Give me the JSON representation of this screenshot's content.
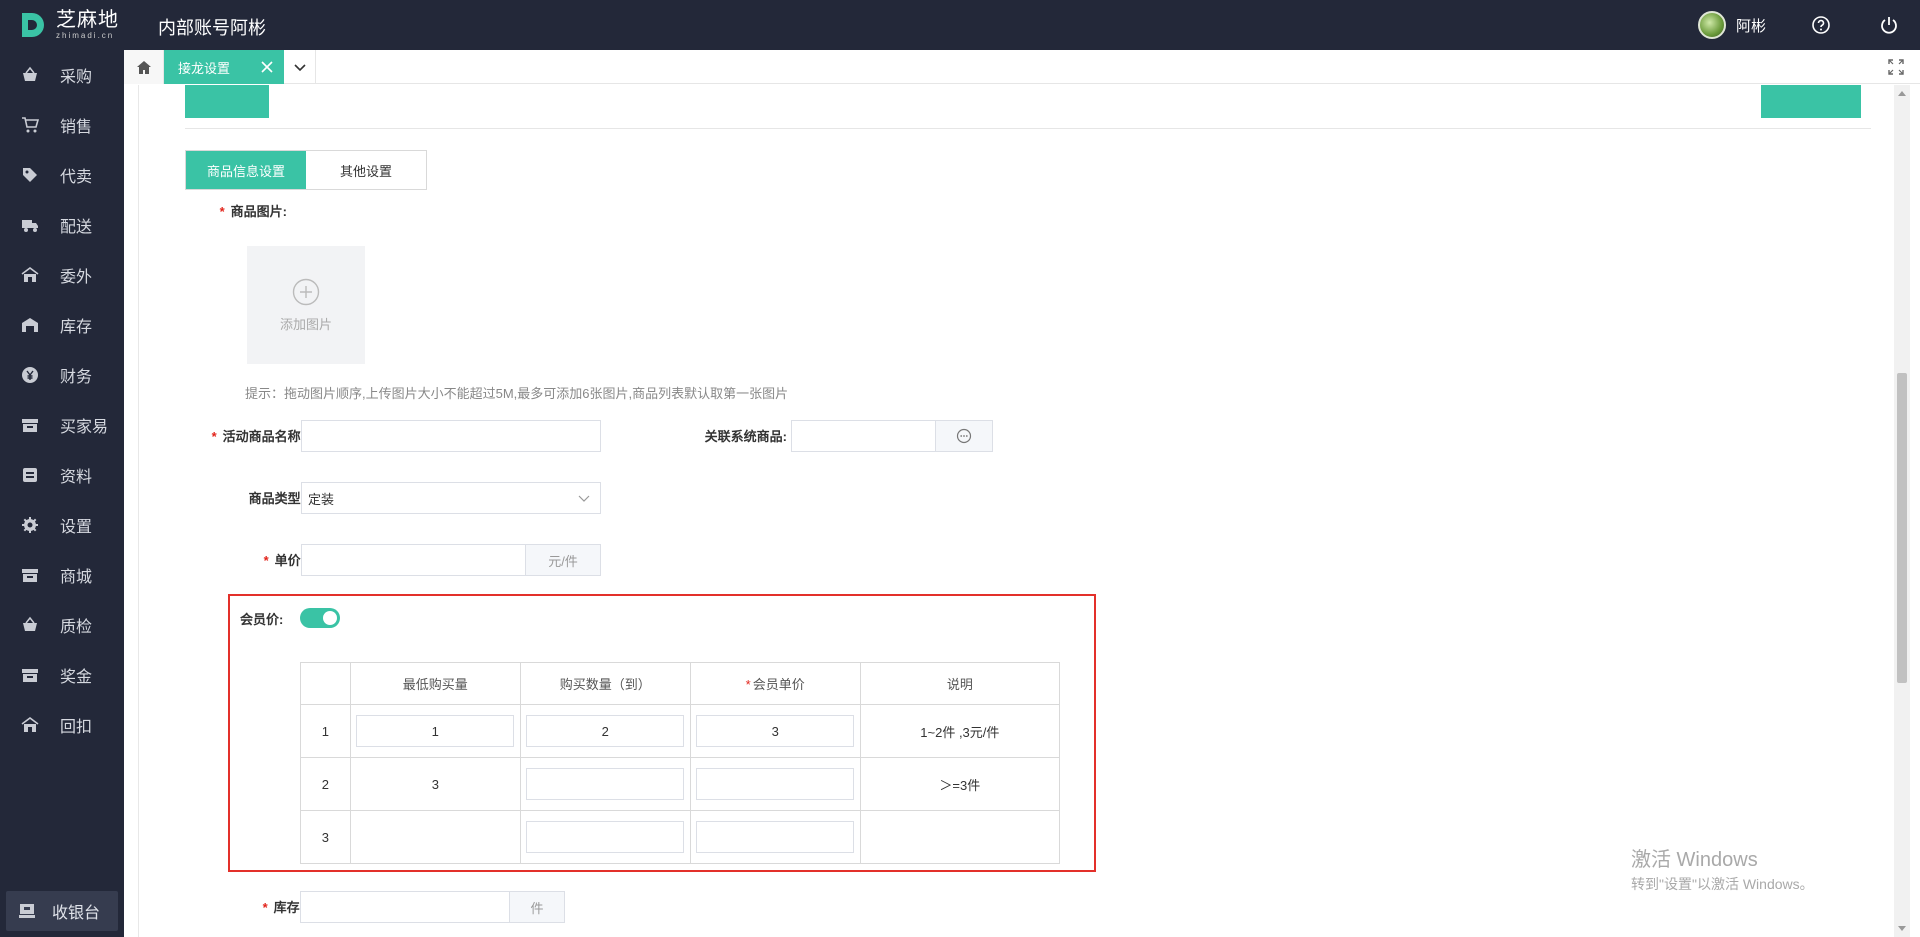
{
  "header": {
    "logo_cn": "芝麻地",
    "logo_en": "zhimadi.cn",
    "title": "内部账号阿彬",
    "username": "阿彬",
    "icons": [
      "help-circle-icon",
      "power-icon"
    ]
  },
  "sidebar": {
    "items": [
      {
        "label": "采购",
        "icon": "basket-icon"
      },
      {
        "label": "销售",
        "icon": "cart-icon"
      },
      {
        "label": "代卖",
        "icon": "tag-icon"
      },
      {
        "label": "配送",
        "icon": "truck-icon"
      },
      {
        "label": "委外",
        "icon": "outsource-icon"
      },
      {
        "label": "库存",
        "icon": "warehouse-icon"
      },
      {
        "label": "财务",
        "icon": "yen-icon"
      },
      {
        "label": "买家易",
        "icon": "store-icon"
      },
      {
        "label": "资料",
        "icon": "box-icon"
      },
      {
        "label": "设置",
        "icon": "gear-icon"
      },
      {
        "label": "商城",
        "icon": "shop-icon"
      },
      {
        "label": "质检",
        "icon": "basket-icon"
      },
      {
        "label": "奖金",
        "icon": "store-icon"
      },
      {
        "label": "回扣",
        "icon": "outsource-icon"
      }
    ],
    "cashier_label": "收银台"
  },
  "tabs": {
    "active_label": "接龙设置"
  },
  "subtabs": [
    "商品信息设置",
    "其他设置"
  ],
  "form": {
    "product_image_label": "商品图片:",
    "add_image_label": "添加图片",
    "hint": "提示：拖动图片顺序,上传图片大小不能超过5M,最多可添加6张图片,商品列表默认取第一张图片",
    "activity_name_label": "活动商品名称:",
    "activity_name_value": "",
    "linked_product_label": "关联系统商品:",
    "linked_product_value": "",
    "product_type_label": "商品类型:",
    "product_type_value": "定装",
    "unit_price_label": "单价:",
    "unit_price_value": "",
    "unit_price_suffix": "元/件",
    "member_price_label": "会员价:",
    "member_price_enabled": true,
    "stock_label": "库存:",
    "stock_value": "",
    "stock_suffix": "件"
  },
  "member_table": {
    "headers": [
      "",
      "最低购买量",
      "购买数量（到）",
      "会员单价",
      "说明"
    ],
    "rows": [
      {
        "index": "1",
        "min": "1",
        "to": "2",
        "price": "3",
        "note": "1~2件 ,3元/件"
      },
      {
        "index": "2",
        "min": "3",
        "to": "",
        "price": "",
        "note": "＞=3件"
      },
      {
        "index": "3",
        "min": "",
        "to": "",
        "price": "",
        "note": ""
      }
    ]
  },
  "watermark": {
    "line1": "激活 Windows",
    "line2": "转到\"设置\"以激活 Windows。"
  },
  "colors": {
    "sidebar_bg": "#232839",
    "accent": "#3ac3a5",
    "required": "#e2231a",
    "highlight_border": "#e3302a"
  }
}
